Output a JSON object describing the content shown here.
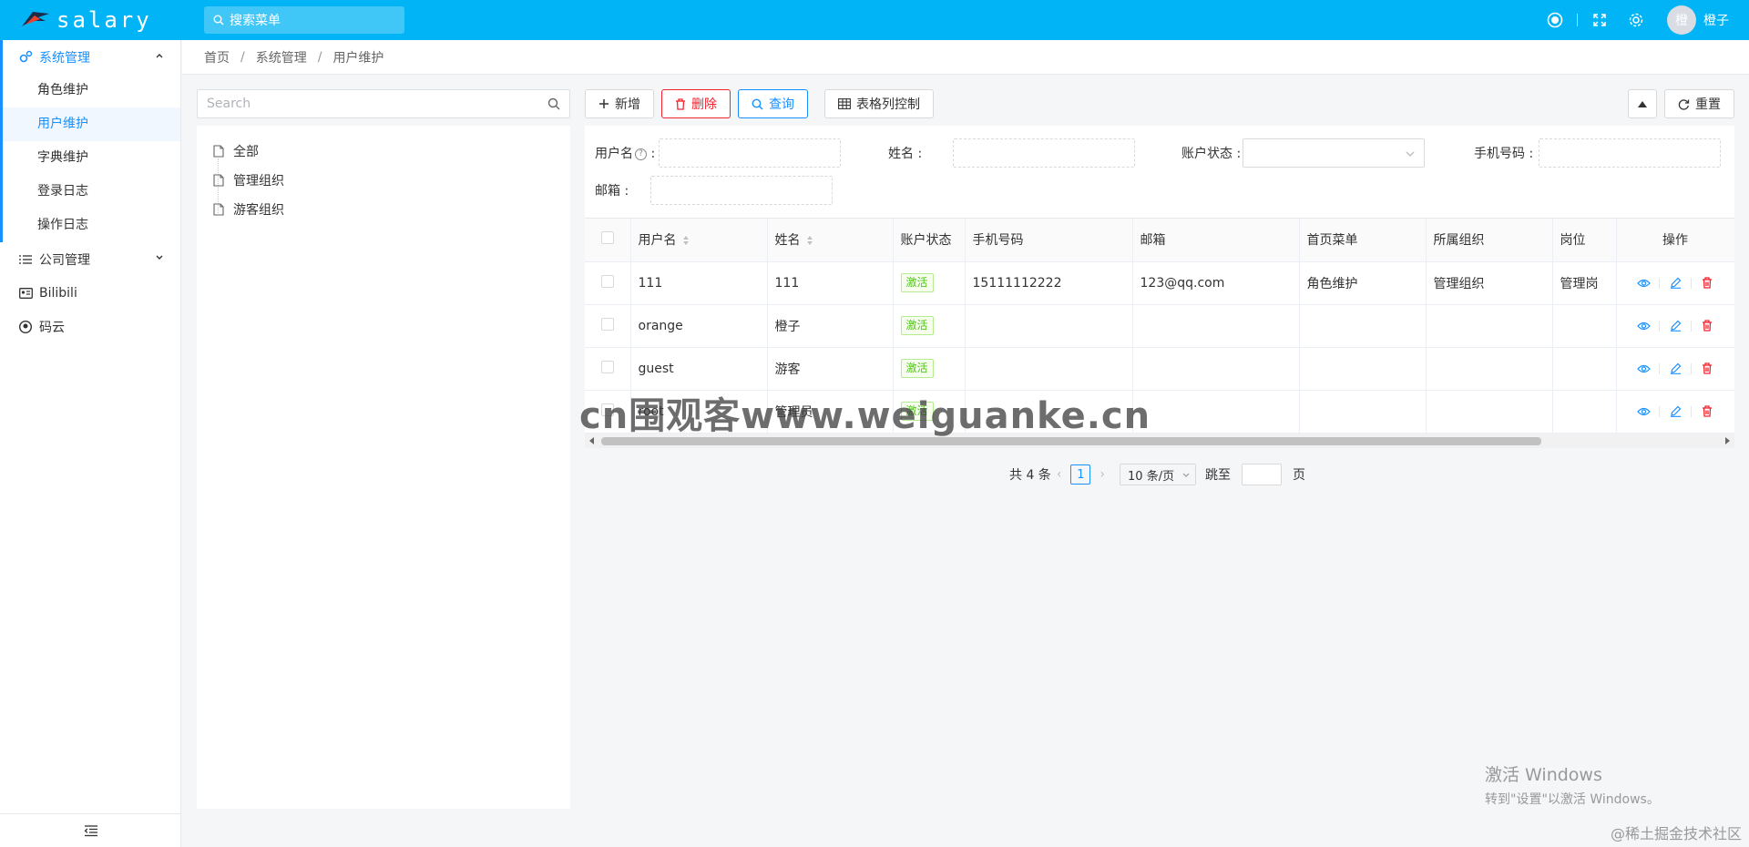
{
  "app": {
    "logo_text": "salary"
  },
  "topbar": {
    "search_placeholder": "搜索菜单",
    "user_avatar_char": "橙",
    "user_name": "橙子"
  },
  "sidebar": {
    "groups": [
      {
        "label": "系统管理",
        "expanded": true,
        "items": [
          "角色维护",
          "用户维护",
          "字典维护",
          "登录日志",
          "操作日志"
        ],
        "active_item": "用户维护"
      },
      {
        "label": "公司管理",
        "expanded": false
      },
      {
        "label": "Bilibili"
      },
      {
        "label": "码云"
      }
    ]
  },
  "breadcrumb": [
    "首页",
    "系统管理",
    "用户维护"
  ],
  "tree": {
    "search_placeholder": "Search",
    "items": [
      "全部",
      "管理组织",
      "游客组织"
    ]
  },
  "toolbar": {
    "add": "新增",
    "delete": "删除",
    "query": "查询",
    "columns": "表格列控制",
    "reset": "重置"
  },
  "filter": {
    "username": "用户名",
    "name": "姓名 :",
    "status": "账户状态 :",
    "phone": "手机号码 :",
    "email": "邮箱 :",
    "colon": ":",
    "qmark": "?"
  },
  "table": {
    "headers": [
      "用户名",
      "姓名",
      "账户状态",
      "手机号码",
      "邮箱",
      "首页菜单",
      "所属组织",
      "岗位",
      "操作"
    ],
    "rows": [
      {
        "username": "111",
        "name": "111",
        "status": "激活",
        "phone": "15111112222",
        "email": "123@qq.com",
        "menu": "角色维护",
        "org": "管理组织",
        "post": "管理岗"
      },
      {
        "username": "orange",
        "name": "橙子",
        "status": "激活",
        "phone": "",
        "email": "",
        "menu": "",
        "org": "",
        "post": ""
      },
      {
        "username": "guest",
        "name": "游客",
        "status": "激活",
        "phone": "",
        "email": "",
        "menu": "",
        "org": "",
        "post": ""
      },
      {
        "username": "root",
        "name": "管理员",
        "status": "激活",
        "phone": "",
        "email": "",
        "menu": "",
        "org": "",
        "post": ""
      }
    ]
  },
  "pagination": {
    "total": "共 4 条",
    "current": "1",
    "page_size": "10 条/页",
    "jump_label": "跳至",
    "page_label": "页"
  },
  "overlay": {
    "watermark": "cn围观客www.weiguanke.cn",
    "win_title": "激活 Windows",
    "win_sub": "转到\"设置\"以激活 Windows。",
    "credit": "@稀土掘金技术社区"
  },
  "colors": {
    "accent": "#1890ff",
    "topbar": "#00b4f6",
    "danger": "#f5222d",
    "success": "#52c41a"
  }
}
